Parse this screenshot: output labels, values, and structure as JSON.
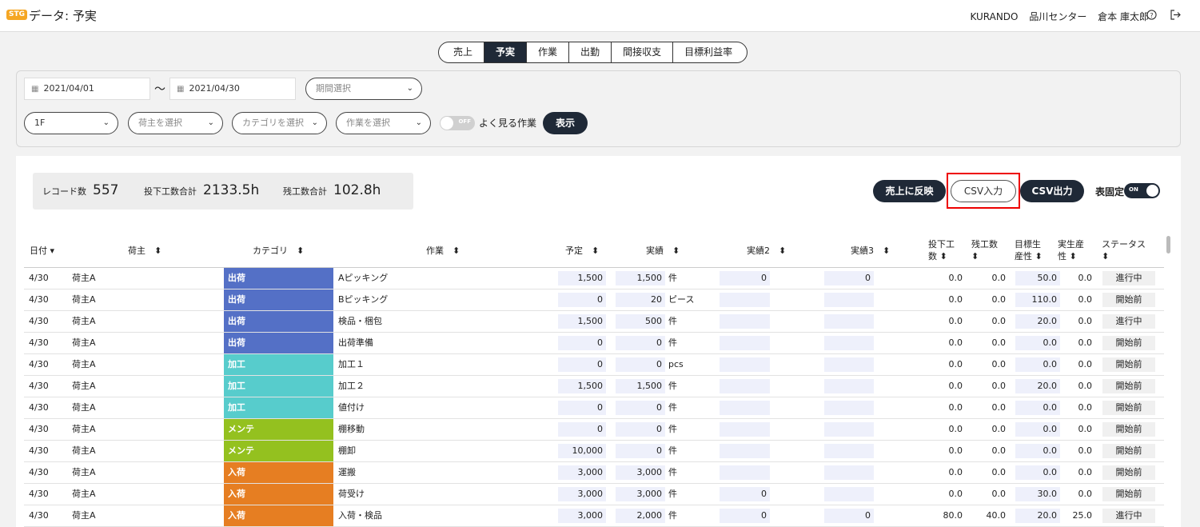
{
  "header": {
    "env_badge": "STG",
    "title": "データ: 予実",
    "company": "KURANDO",
    "center": "品川センター",
    "user": "倉本 庫太郎"
  },
  "tabs": [
    {
      "label": "売上"
    },
    {
      "label": "予実",
      "active": true
    },
    {
      "label": "作業"
    },
    {
      "label": "出勤"
    },
    {
      "label": "間接収支"
    },
    {
      "label": "目標利益率"
    }
  ],
  "filters": {
    "date_from": "2021/04/01",
    "date_sep": "〜",
    "date_to": "2021/04/30",
    "period_placeholder": "期間選択",
    "floor": "1F",
    "shipper_placeholder": "荷主を選択",
    "category_placeholder": "カテゴリを選択",
    "work_placeholder": "作業を選択",
    "fav_toggle": "OFF",
    "fav_label": "よく見る作業",
    "show_button": "表示"
  },
  "summary": {
    "records_label": "レコード数",
    "records": "557",
    "hours_label": "投下工数合計",
    "hours": "2133.5h",
    "overtime_label": "残工数合計",
    "overtime": "102.8h"
  },
  "actions": {
    "reflect": "売上に反映",
    "csv_in": "CSV入力",
    "csv_out": "CSV出力",
    "fix_label": "表固定",
    "fix_toggle": "ON"
  },
  "colors": {
    "出荷": "#5470c6",
    "加工": "#57cccc",
    "メンテ": "#94c11f",
    "入荷": "#e67e22",
    "dark": "#1f2937",
    "highlight": "#e00000"
  },
  "table": {
    "headers": {
      "date": "日付",
      "shipper": "荷主",
      "category": "カテゴリ",
      "work": "作業",
      "plan": "予定",
      "actual": "実績",
      "actual2": "実績2",
      "actual3": "実績3",
      "hours_1": "投下工",
      "hours_2": "数",
      "remain": "残工数",
      "target_1": "目標生",
      "target_2": "産性",
      "real_1": "実生産",
      "real_2": "性",
      "status": "ステータス"
    },
    "rows": [
      {
        "date": "4/30",
        "shipper": "荷主A",
        "category": "出荷",
        "work": "Aピッキング",
        "plan": "1,500",
        "actual": "1,500",
        "unit": "件",
        "a2": "0",
        "a3": "0",
        "hours": "0.0",
        "remain": "0.0",
        "target": "50.0",
        "real": "0.0",
        "status": "進行中"
      },
      {
        "date": "4/30",
        "shipper": "荷主A",
        "category": "出荷",
        "work": "Bピッキング",
        "plan": "0",
        "actual": "20",
        "unit": "ピース",
        "a2": "",
        "a3": "",
        "hours": "0.0",
        "remain": "0.0",
        "target": "110.0",
        "real": "0.0",
        "status": "開始前"
      },
      {
        "date": "4/30",
        "shipper": "荷主A",
        "category": "出荷",
        "work": "検品・梱包",
        "plan": "1,500",
        "actual": "500",
        "unit": "件",
        "a2": "",
        "a3": "",
        "hours": "0.0",
        "remain": "0.0",
        "target": "20.0",
        "real": "0.0",
        "status": "進行中"
      },
      {
        "date": "4/30",
        "shipper": "荷主A",
        "category": "出荷",
        "work": "出荷準備",
        "plan": "0",
        "actual": "0",
        "unit": "件",
        "a2": "",
        "a3": "",
        "hours": "0.0",
        "remain": "0.0",
        "target": "0.0",
        "real": "0.0",
        "status": "開始前"
      },
      {
        "date": "4/30",
        "shipper": "荷主A",
        "category": "加工",
        "work": "加工１",
        "plan": "0",
        "actual": "0",
        "unit": "pcs",
        "a2": "",
        "a3": "",
        "hours": "0.0",
        "remain": "0.0",
        "target": "0.0",
        "real": "0.0",
        "status": "開始前"
      },
      {
        "date": "4/30",
        "shipper": "荷主A",
        "category": "加工",
        "work": "加工２",
        "plan": "1,500",
        "actual": "1,500",
        "unit": "件",
        "a2": "",
        "a3": "",
        "hours": "0.0",
        "remain": "0.0",
        "target": "20.0",
        "real": "0.0",
        "status": "開始前"
      },
      {
        "date": "4/30",
        "shipper": "荷主A",
        "category": "加工",
        "work": "値付け",
        "plan": "0",
        "actual": "0",
        "unit": "件",
        "a2": "",
        "a3": "",
        "hours": "0.0",
        "remain": "0.0",
        "target": "0.0",
        "real": "0.0",
        "status": "開始前"
      },
      {
        "date": "4/30",
        "shipper": "荷主A",
        "category": "メンテ",
        "work": "棚移動",
        "plan": "0",
        "actual": "0",
        "unit": "件",
        "a2": "",
        "a3": "",
        "hours": "0.0",
        "remain": "0.0",
        "target": "0.0",
        "real": "0.0",
        "status": "開始前"
      },
      {
        "date": "4/30",
        "shipper": "荷主A",
        "category": "メンテ",
        "work": "棚卸",
        "plan": "10,000",
        "actual": "0",
        "unit": "件",
        "a2": "",
        "a3": "",
        "hours": "0.0",
        "remain": "0.0",
        "target": "0.0",
        "real": "0.0",
        "status": "開始前"
      },
      {
        "date": "4/30",
        "shipper": "荷主A",
        "category": "入荷",
        "work": "運搬",
        "plan": "3,000",
        "actual": "3,000",
        "unit": "件",
        "a2": "",
        "a3": "",
        "hours": "0.0",
        "remain": "0.0",
        "target": "0.0",
        "real": "0.0",
        "status": "開始前"
      },
      {
        "date": "4/30",
        "shipper": "荷主A",
        "category": "入荷",
        "work": "荷受け",
        "plan": "3,000",
        "actual": "3,000",
        "unit": "件",
        "a2": "0",
        "a3": "",
        "hours": "0.0",
        "remain": "0.0",
        "target": "30.0",
        "real": "0.0",
        "status": "開始前"
      },
      {
        "date": "4/30",
        "shipper": "荷主A",
        "category": "入荷",
        "work": "入荷・検品",
        "plan": "3,000",
        "actual": "2,000",
        "unit": "件",
        "a2": "0",
        "a3": "0",
        "hours": "80.0",
        "remain": "40.0",
        "target": "20.0",
        "real": "25.0",
        "status": "進行中"
      }
    ]
  }
}
